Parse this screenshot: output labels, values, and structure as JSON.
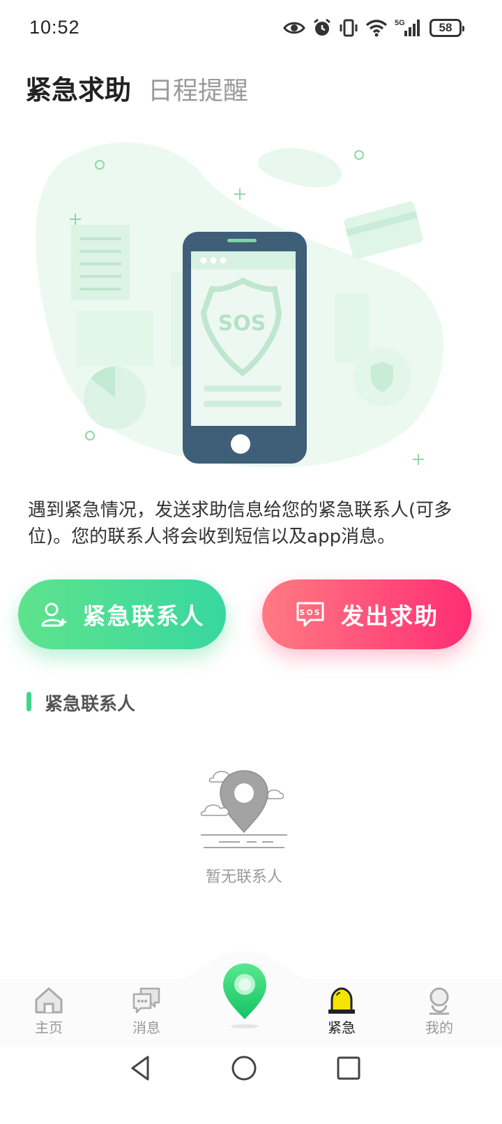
{
  "status_bar": {
    "time": "10:52",
    "battery": "58",
    "network": "5G",
    "icons": [
      "eye-icon",
      "alarm-icon",
      "vibrate-icon",
      "wifi-icon",
      "signal-icon",
      "battery-icon"
    ]
  },
  "tabs": {
    "active": "紧急求助",
    "inactive": "日程提醒"
  },
  "hero": {
    "badge_text": "SOS"
  },
  "description": "遇到紧急情况，发送求助信息给您的紧急联系人(可多位)。您的联系人将会收到短信以及app消息。",
  "buttons": {
    "contacts_label": "紧急联系人",
    "sos_label": "发出求助",
    "sos_icon_text": "SOS"
  },
  "section": {
    "title": "紧急联系人"
  },
  "empty_state": {
    "text": "暂无联系人"
  },
  "bottom_nav": {
    "items": [
      {
        "label": "主页",
        "icon": "home-icon"
      },
      {
        "label": "消息",
        "icon": "message-icon"
      },
      {
        "label": "",
        "icon": "location-pin-icon"
      },
      {
        "label": "紧急",
        "icon": "alarm-light-icon"
      },
      {
        "label": "我的",
        "icon": "profile-icon"
      }
    ],
    "active_index": 3
  },
  "colors": {
    "green_accent": "#3ed68a",
    "pink_accent": "#ff2d74",
    "active_nav_icon": "#f5e400"
  }
}
